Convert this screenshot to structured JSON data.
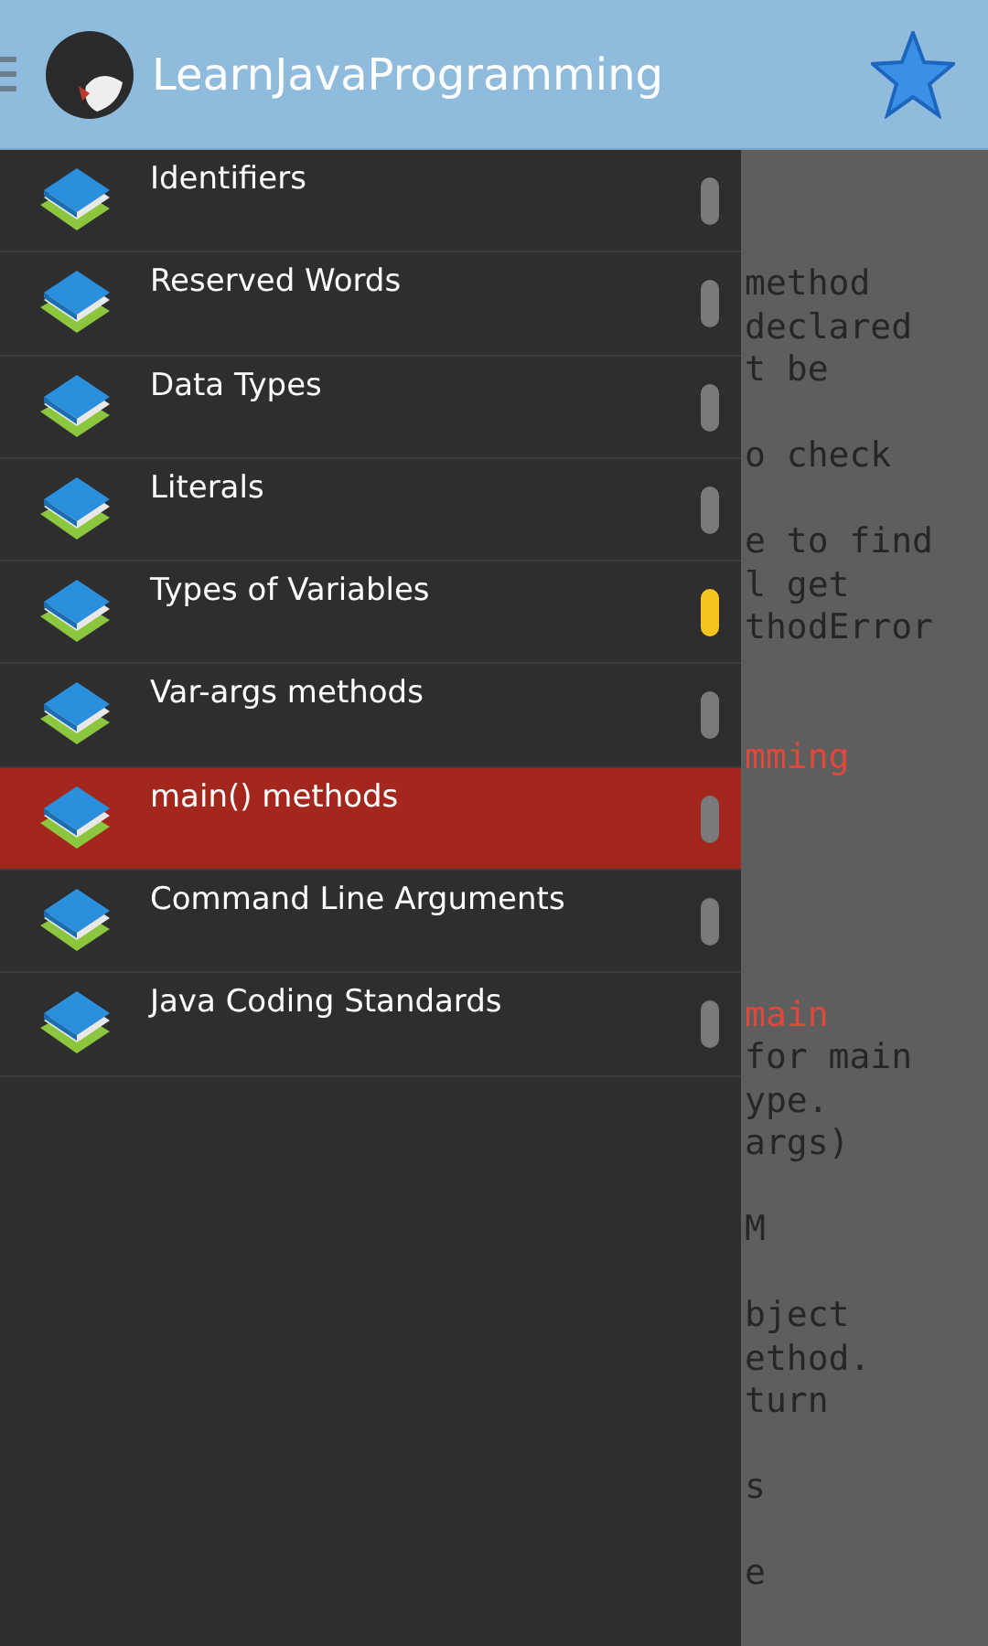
{
  "app_bar": {
    "title": "LearnJavaProgramming"
  },
  "drawer": {
    "items": [
      {
        "label": "Identifiers",
        "selected": false,
        "marked": false
      },
      {
        "label": "Reserved Words",
        "selected": false,
        "marked": false
      },
      {
        "label": "Data Types",
        "selected": false,
        "marked": false
      },
      {
        "label": "Literals",
        "selected": false,
        "marked": false
      },
      {
        "label": "Types of Variables",
        "selected": false,
        "marked": true
      },
      {
        "label": "Var-args methods",
        "selected": false,
        "marked": false
      },
      {
        "label": "main() methods",
        "selected": true,
        "marked": false
      },
      {
        "label": "Command Line Arguments",
        "selected": false,
        "marked": false
      },
      {
        "label": "Java Coding Standards",
        "selected": false,
        "marked": false
      }
    ]
  },
  "content": {
    "lines": [
      {
        "kind": "text",
        "text": "method"
      },
      {
        "kind": "text",
        "text": "declared"
      },
      {
        "kind": "text",
        "text": "t be"
      },
      {
        "kind": "blank"
      },
      {
        "kind": "text",
        "text": "o check"
      },
      {
        "kind": "blank"
      },
      {
        "kind": "text",
        "text": "e to find"
      },
      {
        "kind": "text",
        "text": "l get"
      },
      {
        "kind": "text",
        "text": "thodError"
      },
      {
        "kind": "blank"
      },
      {
        "kind": "blank"
      },
      {
        "kind": "heading",
        "text": "mming"
      },
      {
        "kind": "blank"
      },
      {
        "kind": "blank"
      },
      {
        "kind": "blank"
      },
      {
        "kind": "blank"
      },
      {
        "kind": "blank"
      },
      {
        "kind": "heading",
        "text": "main"
      },
      {
        "kind": "text",
        "text": "for main"
      },
      {
        "kind": "text",
        "text": "ype."
      },
      {
        "kind": "text",
        "text": "args)"
      },
      {
        "kind": "blank"
      },
      {
        "kind": "text",
        "text": "M"
      },
      {
        "kind": "blank"
      },
      {
        "kind": "text",
        "text": "bject"
      },
      {
        "kind": "text",
        "text": "ethod."
      },
      {
        "kind": "text",
        "text": "turn"
      },
      {
        "kind": "blank"
      },
      {
        "kind": "text",
        "text": "s"
      },
      {
        "kind": "blank"
      },
      {
        "kind": "text",
        "text": "e"
      }
    ]
  }
}
